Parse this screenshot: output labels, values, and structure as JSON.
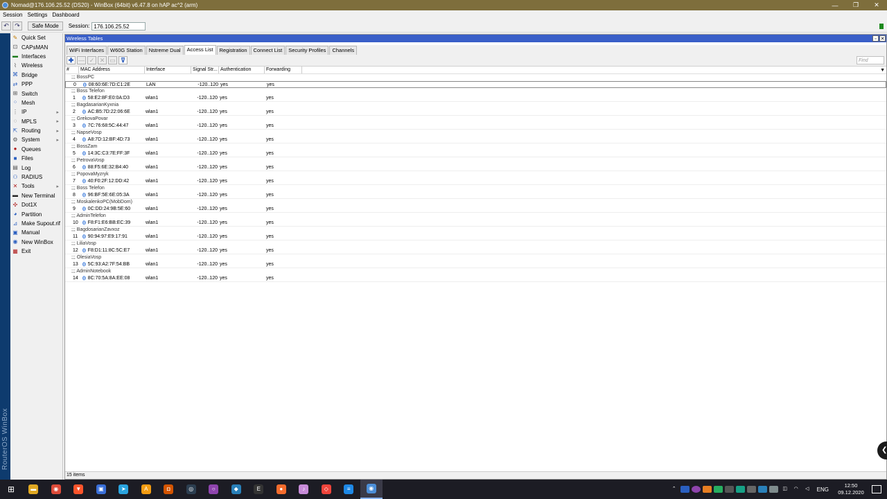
{
  "window": {
    "title": "Nomad@176.106.25.52 (DS20) - WinBox (64bit) v6.47.8 on hAP ac^2 (arm)",
    "controls": [
      "—",
      "❐",
      "✕"
    ]
  },
  "menu": [
    "Session",
    "Settings",
    "Dashboard"
  ],
  "toolbar": {
    "undo": "↶",
    "redo": "↷",
    "safe_mode": "Safe Mode",
    "session_label": "Session:",
    "session_value": "176.106.25.52"
  },
  "brand": "RouterOS WinBox",
  "sidebar": [
    {
      "label": "Quick Set",
      "icon": "quick-set-icon",
      "glyph": "✎",
      "color": "#c07a00",
      "arrow": false
    },
    {
      "label": "CAPsMAN",
      "icon": "capsman-icon",
      "glyph": "⊡",
      "color": "#555",
      "arrow": false
    },
    {
      "label": "Interfaces",
      "icon": "interfaces-icon",
      "glyph": "▬",
      "color": "#1a7a1a",
      "arrow": false
    },
    {
      "label": "Wireless",
      "icon": "wireless-icon",
      "glyph": "⌇",
      "color": "#555",
      "arrow": false
    },
    {
      "label": "Bridge",
      "icon": "bridge-icon",
      "glyph": "⌘",
      "color": "#2a5fc0",
      "arrow": false
    },
    {
      "label": "PPP",
      "icon": "ppp-icon",
      "glyph": "⇄",
      "color": "#2a5fc0",
      "arrow": false
    },
    {
      "label": "Switch",
      "icon": "switch-icon",
      "glyph": "⊞",
      "color": "#555",
      "arrow": false
    },
    {
      "label": "Mesh",
      "icon": "mesh-icon",
      "glyph": "⁘",
      "color": "#2a5fc0",
      "arrow": false
    },
    {
      "label": "IP",
      "icon": "ip-icon",
      "glyph": "⋮",
      "color": "#555",
      "arrow": true
    },
    {
      "label": "MPLS",
      "icon": "mpls-icon",
      "glyph": "◌",
      "color": "#555",
      "arrow": true
    },
    {
      "label": "Routing",
      "icon": "routing-icon",
      "glyph": "⇱",
      "color": "#2a5fc0",
      "arrow": true
    },
    {
      "label": "System",
      "icon": "system-icon",
      "glyph": "⚙",
      "color": "#555",
      "arrow": true
    },
    {
      "label": "Queues",
      "icon": "queues-icon",
      "glyph": "●",
      "color": "#b02020",
      "arrow": false
    },
    {
      "label": "Files",
      "icon": "files-icon",
      "glyph": "■",
      "color": "#2a5fc0",
      "arrow": false
    },
    {
      "label": "Log",
      "icon": "log-icon",
      "glyph": "▤",
      "color": "#555",
      "arrow": false
    },
    {
      "label": "RADIUS",
      "icon": "radius-icon",
      "glyph": "⚇",
      "color": "#2a5fc0",
      "arrow": false
    },
    {
      "label": "Tools",
      "icon": "tools-icon",
      "glyph": "✕",
      "color": "#b02020",
      "arrow": true
    },
    {
      "label": "New Terminal",
      "icon": "terminal-icon",
      "glyph": "▬",
      "color": "#222",
      "arrow": false
    },
    {
      "label": "Dot1X",
      "icon": "dot1x-icon",
      "glyph": "✣",
      "color": "#b02020",
      "arrow": false
    },
    {
      "label": "Partition",
      "icon": "partition-icon",
      "glyph": "◕",
      "color": "#2a5fc0",
      "arrow": false
    },
    {
      "label": "Make Supout.rif",
      "icon": "supout-icon",
      "glyph": "⊿",
      "color": "#2a5fc0",
      "arrow": false
    },
    {
      "label": "Manual",
      "icon": "manual-icon",
      "glyph": "▣",
      "color": "#2a5fc0",
      "arrow": false
    },
    {
      "label": "New WinBox",
      "icon": "winbox-icon",
      "glyph": "◉",
      "color": "#2a5fc0",
      "arrow": false
    },
    {
      "label": "Exit",
      "icon": "exit-icon",
      "glyph": "▦",
      "color": "#b02020",
      "arrow": false
    }
  ],
  "panel": {
    "title": "Wireless Tables",
    "tabs": [
      {
        "label": "WiFi Interfaces",
        "active": false
      },
      {
        "label": "W60G Station",
        "active": false
      },
      {
        "label": "Nstreme Dual",
        "active": false
      },
      {
        "label": "Access List",
        "active": true
      },
      {
        "label": "Registration",
        "active": false
      },
      {
        "label": "Connect List",
        "active": false
      },
      {
        "label": "Security Profiles",
        "active": false
      },
      {
        "label": "Channels",
        "active": false
      }
    ],
    "find_placeholder": "Find",
    "columns": [
      "#",
      "MAC Address",
      "Interface",
      "Signal Str...",
      "Authentication",
      "Forwarding"
    ],
    "rows": [
      {
        "comment": ";;; BossPC",
        "n": "0",
        "mac": "08:60:6E:7D:C1:2E",
        "iface": "LAN",
        "signal": "-120..120",
        "auth": "yes",
        "fwd": "yes"
      },
      {
        "comment": ";;; Boss Telefon",
        "n": "1",
        "mac": "58:E2:8F:E0:0A:D3",
        "iface": "wlan1",
        "signal": "-120..120",
        "auth": "yes",
        "fwd": "yes"
      },
      {
        "comment": ";;; BagdasarianKyxnia",
        "n": "2",
        "mac": "AC:B5:7D:22:06:6E",
        "iface": "wlan1",
        "signal": "-120..120",
        "auth": "yes",
        "fwd": "yes"
      },
      {
        "comment": ";;; GrekovaPovar",
        "n": "3",
        "mac": "7C:76:68:5C:44:47",
        "iface": "wlan1",
        "signal": "-120..120",
        "auth": "yes",
        "fwd": "yes"
      },
      {
        "comment": ";;; NapseVosp",
        "n": "4",
        "mac": "A8:7D:12:BF:4D:73",
        "iface": "wlan1",
        "signal": "-120..120",
        "auth": "yes",
        "fwd": "yes"
      },
      {
        "comment": ";;; BossZam",
        "n": "5",
        "mac": "14:3C:C3:7E:FF:3F",
        "iface": "wlan1",
        "signal": "-120..120",
        "auth": "yes",
        "fwd": "yes"
      },
      {
        "comment": ";;; PetrovaVosp",
        "n": "6",
        "mac": "88:F5:6E:32:B4:40",
        "iface": "wlan1",
        "signal": "-120..120",
        "auth": "yes",
        "fwd": "yes"
      },
      {
        "comment": ";;; PopovaMyzryk",
        "n": "7",
        "mac": "40:F0:2F:12:DD:42",
        "iface": "wlan1",
        "signal": "-120..120",
        "auth": "yes",
        "fwd": "yes"
      },
      {
        "comment": ";;; Boss Telefon",
        "n": "8",
        "mac": "96:BF:5E:6E:05:3A",
        "iface": "wlan1",
        "signal": "-120..120",
        "auth": "yes",
        "fwd": "yes"
      },
      {
        "comment": ";;; MoskalenkoPC(MobDom)",
        "n": "9",
        "mac": "0C:DD:24:9B:5E:60",
        "iface": "wlan1",
        "signal": "-120..120",
        "auth": "yes",
        "fwd": "yes"
      },
      {
        "comment": ";;; AdminTelefon",
        "n": "10",
        "mac": "F8:F1:E6:BB:EC:39",
        "iface": "wlan1",
        "signal": "-120..120",
        "auth": "yes",
        "fwd": "yes"
      },
      {
        "comment": ";;; BagdosarianZavxoz",
        "n": "11",
        "mac": "90:94:97:E9:17:91",
        "iface": "wlan1",
        "signal": "-120..120",
        "auth": "yes",
        "fwd": "yes"
      },
      {
        "comment": ";;; LiliaVosp",
        "n": "12",
        "mac": "F8:D1:11:8C:5C:E7",
        "iface": "wlan1",
        "signal": "-120..120",
        "auth": "yes",
        "fwd": "yes"
      },
      {
        "comment": ";;; OlesiaVosp",
        "n": "13",
        "mac": "5C:93:A2:7F:54:BB",
        "iface": "wlan1",
        "signal": "-120..120",
        "auth": "yes",
        "fwd": "yes"
      },
      {
        "comment": ";;; AdminNotebook",
        "n": "14",
        "mac": "8C:70:5A:8A:EE:08",
        "iface": "wlan1",
        "signal": "-120..120",
        "auth": "yes",
        "fwd": "yes"
      }
    ],
    "status": "15 items"
  },
  "taskbar": {
    "apps": [
      {
        "name": "file-explorer-icon",
        "color": "#e0a823",
        "glyph": "▬"
      },
      {
        "name": "chrome-icon",
        "color": "#dd4b39",
        "glyph": "◉"
      },
      {
        "name": "brave-icon",
        "color": "#fb542b",
        "glyph": "▼"
      },
      {
        "name": "floppy-icon",
        "color": "#3a6fd8",
        "glyph": "▣"
      },
      {
        "name": "telegram-icon",
        "color": "#2aa3de",
        "glyph": "➤"
      },
      {
        "name": "avast-icon",
        "color": "#f39c12",
        "glyph": "A"
      },
      {
        "name": "office-icon",
        "color": "#d35400",
        "glyph": "◘"
      },
      {
        "name": "steam-icon",
        "color": "#2c3e50",
        "glyph": "◎"
      },
      {
        "name": "purple-app-icon",
        "color": "#8e44ad",
        "glyph": "○"
      },
      {
        "name": "vpn-icon",
        "color": "#2980b9",
        "glyph": "◆"
      },
      {
        "name": "epic-games-icon",
        "color": "#333333",
        "glyph": "E"
      },
      {
        "name": "origin-icon",
        "color": "#f56c2d",
        "glyph": "●"
      },
      {
        "name": "itunes-icon",
        "color": "#c78bd8",
        "glyph": "♪"
      },
      {
        "name": "anydesk-icon",
        "color": "#ef443b",
        "glyph": "◇"
      },
      {
        "name": "stream-app-icon",
        "color": "#1e88e5",
        "glyph": "≡"
      },
      {
        "name": "winbox-task-icon",
        "color": "#4c8ed8",
        "glyph": "◉"
      }
    ],
    "lang": "ENG",
    "time": "12:50",
    "date": "09.12.2020"
  }
}
